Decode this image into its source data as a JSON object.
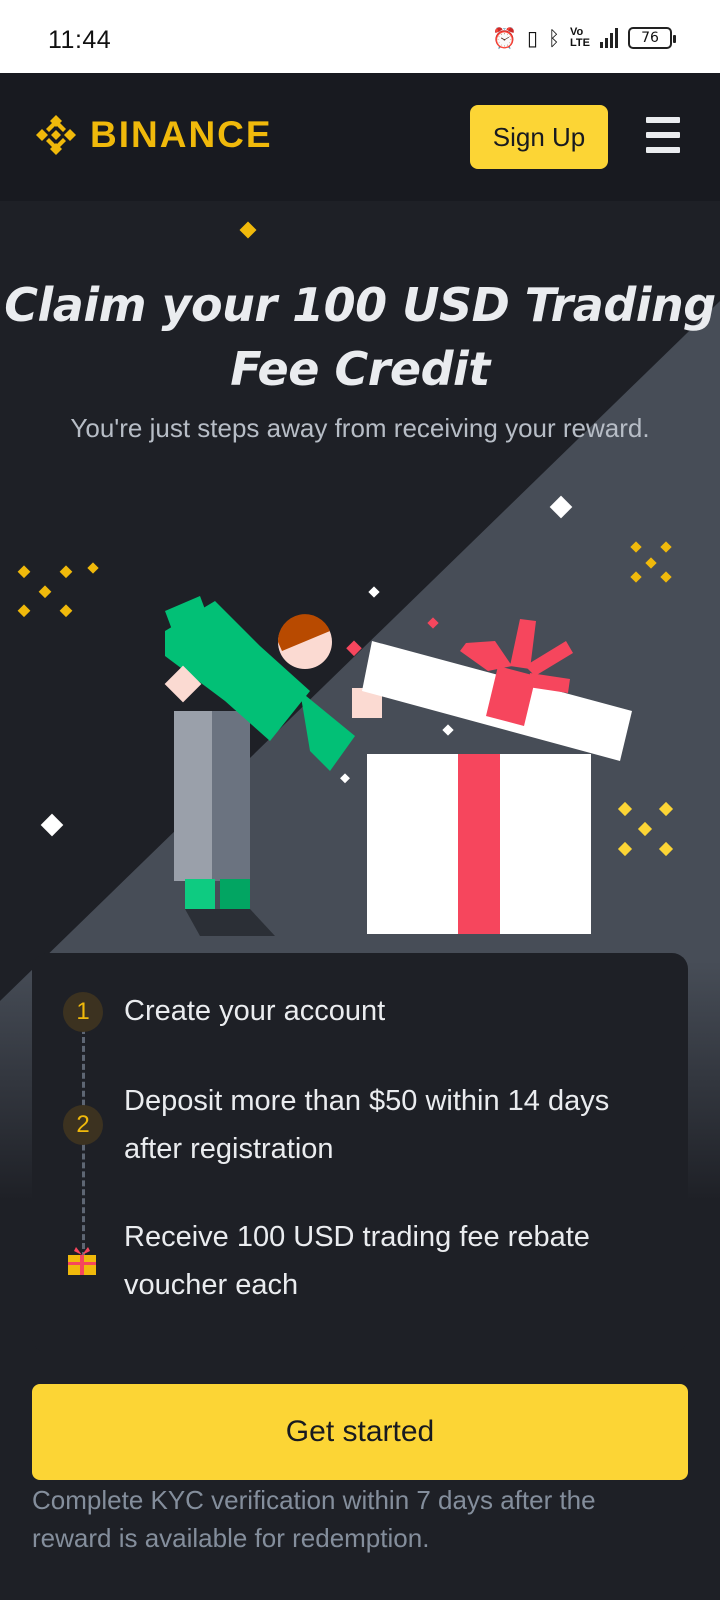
{
  "status_bar": {
    "time": "11:44",
    "battery": "76"
  },
  "header": {
    "brand": "BINANCE",
    "signup_label": "Sign Up",
    "brand_color": "#f0b90b"
  },
  "hero": {
    "title_line1": "Claim your 100 USD Trading",
    "title_line2": "Fee Credit",
    "subtitle": "You're just steps away from receiving your reward."
  },
  "steps": [
    {
      "number": "1",
      "text": "Create your account"
    },
    {
      "number": "2",
      "text": "Deposit more than $50 within 14 days after registration"
    },
    {
      "icon": "gift-icon",
      "text": "Receive 100 USD trading fee rebate voucher each"
    }
  ],
  "cta": {
    "label": "Get started",
    "color": "#fcd535"
  },
  "kyc_note": "Complete KYC verification within 7 days after the reward is available for redemption."
}
